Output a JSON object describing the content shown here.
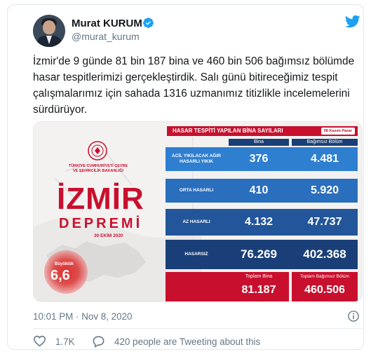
{
  "author": {
    "name": "Murat KURUM",
    "handle": "@murat_kurum"
  },
  "tweet": {
    "text": "İzmir'de 9 günde 81 bin 187 bina ve 460 bin 506 bağımsız bölümde hasar tespitlerimizi gerçekleştirdik. Salı günü bitireceğimiz tespit çalışmalarımız için sahada 1316 uzmanımız titizlikle incelemelerini sürdürüyor.",
    "timestamp": "10:01 PM · Nov 8, 2020",
    "likes": "1.7K",
    "tweeting": "420 people are Tweeting about this"
  },
  "infographic": {
    "ministry": "TÜRKİYE CUMHURİYETİ ÇEVRE VE ŞEHİRCİLİK BAKANLIĞI",
    "city": "İZMİR",
    "event": "DEPREMİ",
    "event_date": "30 EKİM 2020",
    "magnitude_label": "Büyüklük",
    "magnitude": "6,6",
    "header": "HASAR TESPİTİ YAPILAN BİNA SAYILARI",
    "header_date": "08 Kasım Pazar",
    "col_bina": "Bina",
    "col_bagimsiz": "Bağımsız Bölüm",
    "rows": [
      {
        "label": "ACİL YIKILACAK AĞIR HASARLI YIKIK",
        "bina": "376",
        "bagimsiz": "4.481"
      },
      {
        "label": "ORTA HASARLI",
        "bina": "410",
        "bagimsiz": "5.920"
      },
      {
        "label": "AZ HASARLI",
        "bina": "4.132",
        "bagimsiz": "47.737"
      },
      {
        "label": "HASARSIZ",
        "bina": "76.269",
        "bagimsiz": "402.368"
      }
    ],
    "total_bina_label": "Toplam Bina",
    "total_bina": "81.187",
    "total_bagimsiz_label": "Toplam Bağımsız Bölüm",
    "total_bagimsiz": "460.506"
  },
  "colors": {
    "twitter_blue": "#1da1f2",
    "brand_red": "#c8102e",
    "table_blue_dark": "#1a3f78",
    "table_blue_light": "#2f7fd1"
  },
  "icons": [
    "verified-icon",
    "twitter-bird-icon",
    "info-icon",
    "heart-icon",
    "reply-bubble-icon"
  ]
}
